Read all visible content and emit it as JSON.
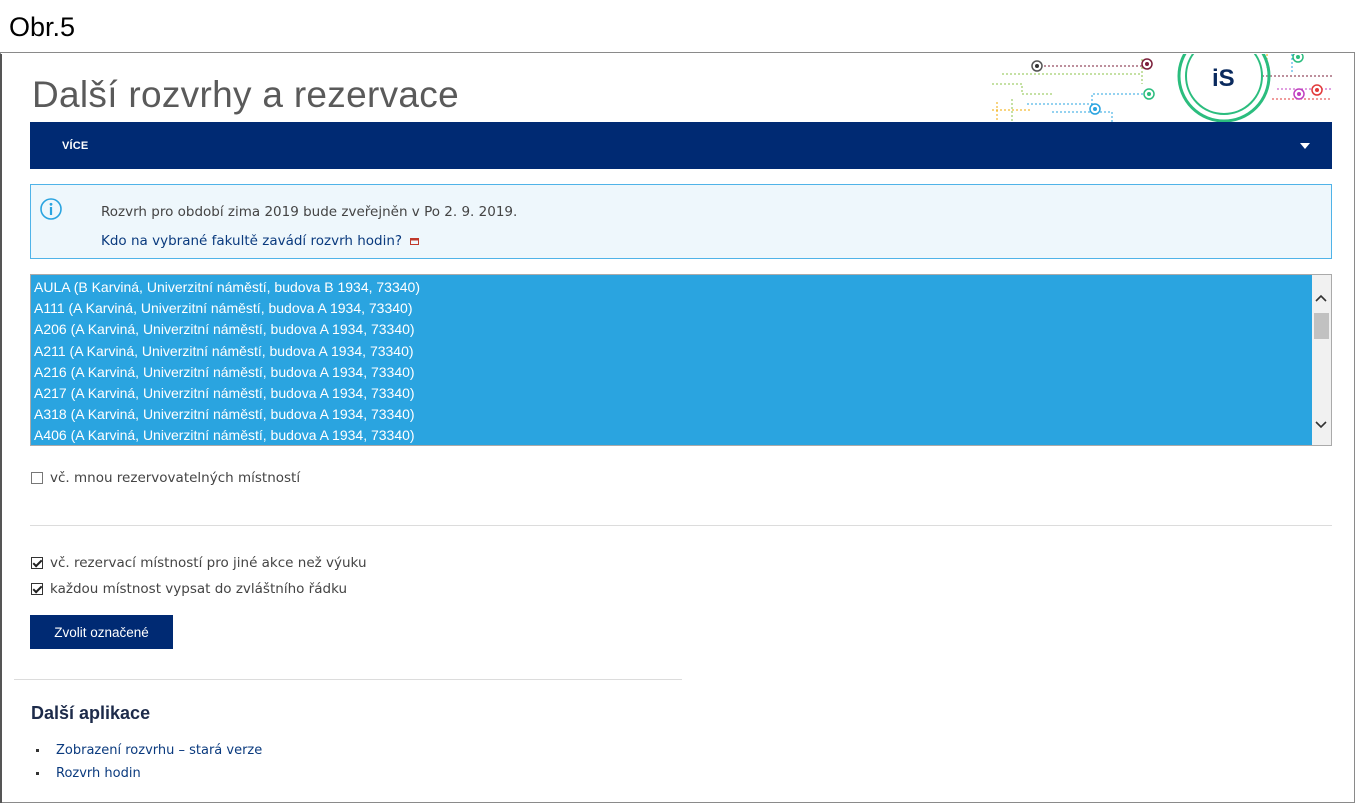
{
  "figure": {
    "label": "Obr.5"
  },
  "page": {
    "title": "Další rozvrhy a rezervace"
  },
  "logo": {
    "text": "iS"
  },
  "navbar": {
    "label": "VÍCE"
  },
  "info": {
    "message": "Rozvrh pro období zima 2019 bude zveřejněn v Po 2. 9. 2019.",
    "link_text": "Kdo na vybrané fakultě zavádí rozvrh hodin?"
  },
  "rooms": {
    "options": [
      "AULA (B Karviná, Univerzitní náměstí, budova B 1934, 73340)",
      "A111 (A Karviná, Univerzitní náměstí, budova A 1934, 73340)",
      "A206 (A Karviná, Univerzitní náměstí, budova A 1934, 73340)",
      "A211 (A Karviná, Univerzitní náměstí, budova A 1934, 73340)",
      "A216 (A Karviná, Univerzitní náměstí, budova A 1934, 73340)",
      "A217 (A Karviná, Univerzitní náměstí, budova A 1934, 73340)",
      "A318 (A Karviná, Univerzitní náměstí, budova A 1934, 73340)",
      "A406 (A Karviná, Univerzitní náměstí, budova A 1934, 73340)"
    ]
  },
  "options": {
    "include_many": {
      "label": "vč. mnou rezervovatelných místností",
      "checked": false
    },
    "include_other": {
      "label": "vč. rezervací místností pro jiné akce než výuku",
      "checked": true
    },
    "separate_rows": {
      "label": "každou místnost vypsat do zvláštního řádku",
      "checked": true
    }
  },
  "submit": {
    "label": "Zvolit označené"
  },
  "apps": {
    "heading": "Další aplikace",
    "items": [
      {
        "label": "Zobrazení rozvrhu – stará verze"
      },
      {
        "label": "Rozvrh hodin"
      }
    ]
  },
  "colors": {
    "navy": "#002a73",
    "selection_blue": "#2aa4e0",
    "info_border": "#4fb3e8",
    "info_bg": "#eef7fc",
    "logo_green": "#2bbd7e"
  }
}
